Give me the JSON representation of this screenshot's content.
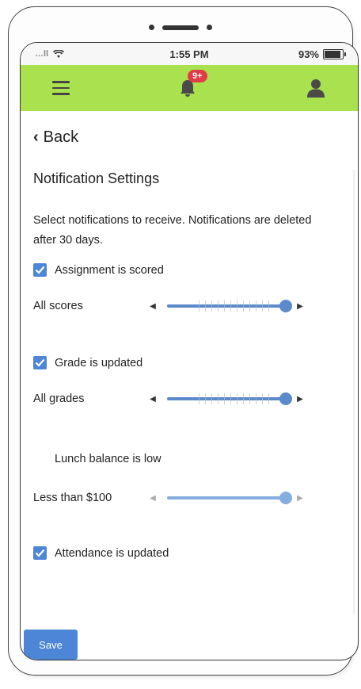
{
  "status_bar": {
    "signal": "…ll",
    "time": "1:55 PM",
    "battery_percent_label": "93%",
    "battery_level": 0.93
  },
  "header": {
    "notification_badge": "9+",
    "accent_color": "#a9e24e",
    "icons": [
      "menu-icon",
      "bell-icon",
      "user-icon"
    ]
  },
  "nav": {
    "back_label": "Back"
  },
  "page": {
    "title": "Notification Settings",
    "description": "Select notifications to receive. Notifications are deleted after 30 days."
  },
  "settings": [
    {
      "label": "Assignment is scored",
      "checked": true,
      "slider_label": "All scores",
      "slider_value": 1.0
    },
    {
      "label": "Grade is updated",
      "checked": true,
      "slider_label": "All grades",
      "slider_value": 1.0
    },
    {
      "label": "Lunch balance is low",
      "checked": false,
      "slider_label": "Less than $100",
      "slider_value": 1.0
    },
    {
      "label": "Attendance is updated",
      "checked": true
    }
  ],
  "footer": {
    "save_label": "Save",
    "button_color": "#4d86d6"
  }
}
